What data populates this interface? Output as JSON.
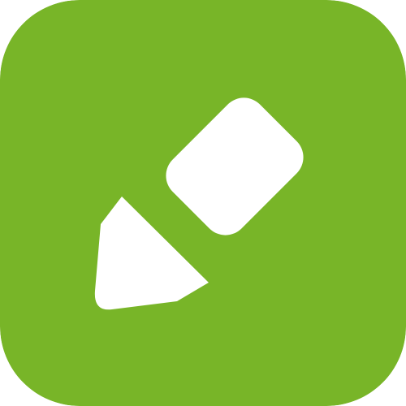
{
  "app_icon": {
    "icon": "pencil-icon",
    "background_color": "#78B528",
    "glyph_color": "#FFFFFF"
  }
}
